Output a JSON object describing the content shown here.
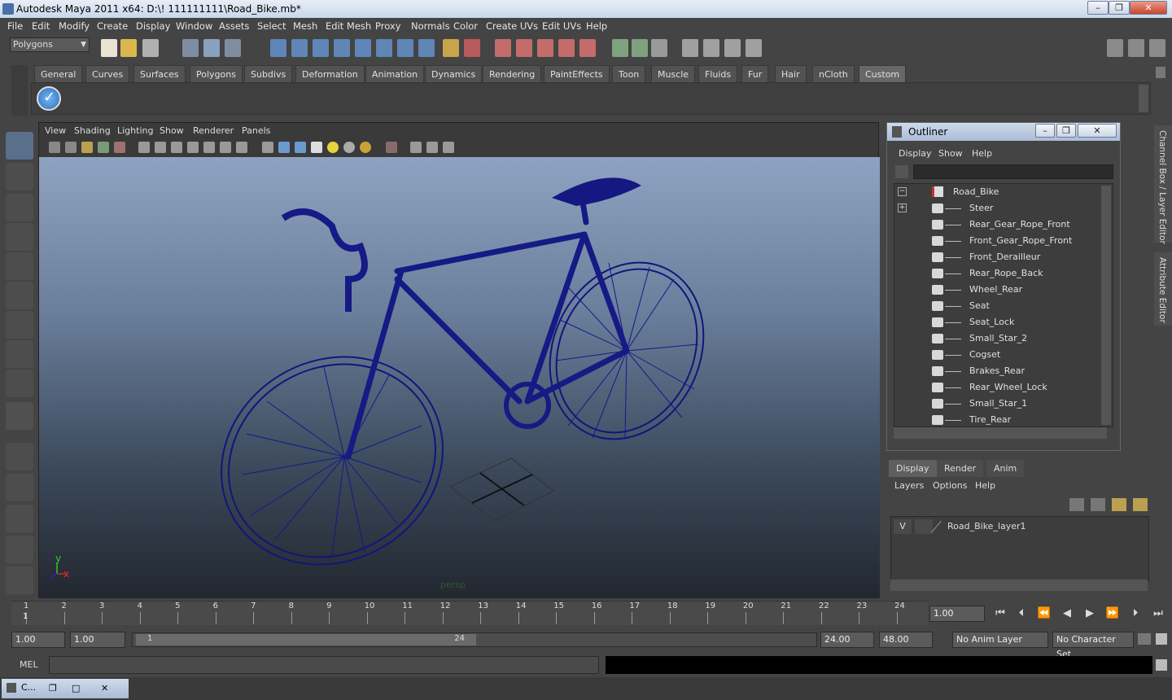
{
  "window": {
    "title": "Autodesk Maya 2011 x64: D:\\! 111111111\\Road_Bike.mb*",
    "minimize": "–",
    "maximize": "❐",
    "close": "✕"
  },
  "menubar": {
    "items": [
      "File",
      "Edit",
      "Modify",
      "Create",
      "Display",
      "Window",
      "Assets",
      "Select",
      "Mesh",
      "Edit Mesh",
      "Proxy",
      "Normals",
      "Color",
      "Create UVs",
      "Edit UVs",
      "Help"
    ]
  },
  "status": {
    "menu_set": "Polygons"
  },
  "shelf": {
    "tabs": [
      "General",
      "Curves",
      "Surfaces",
      "Polygons",
      "Subdivs",
      "Deformation",
      "Animation",
      "Dynamics",
      "Rendering",
      "PaintEffects",
      "Toon",
      "Muscle",
      "Fluids",
      "Fur",
      "Hair",
      "nCloth",
      "Custom"
    ],
    "active_tab": "Custom"
  },
  "viewport": {
    "menu": [
      "View",
      "Shading",
      "Lighting",
      "Show",
      "Renderer",
      "Panels"
    ],
    "camera_label": "persp",
    "axis_x": "x",
    "axis_y": "y"
  },
  "outliner": {
    "title": "Outliner",
    "menu": [
      "Display",
      "Show",
      "Help"
    ],
    "root": "Road_Bike",
    "items": [
      "Steer",
      "Rear_Gear_Rope_Front",
      "Front_Gear_Rope_Front",
      "Front_Derailleur",
      "Rear_Rope_Back",
      "Wheel_Rear",
      "Seat",
      "Seat_Lock",
      "Small_Star_2",
      "Cogset",
      "Brakes_Rear",
      "Rear_Wheel_Lock",
      "Small_Star_1",
      "Tire_Rear"
    ],
    "collapse_sign": "−",
    "expand_sign": "+"
  },
  "layer_editor": {
    "tabs": [
      "Display",
      "Render",
      "Anim"
    ],
    "active_tab": "Display",
    "menu": [
      "Layers",
      "Options",
      "Help"
    ],
    "layer": {
      "visible": "V",
      "name": "Road_Bike_layer1"
    }
  },
  "side_tabs": {
    "channel_box": "Channel Box / Layer Editor",
    "attribute_editor": "Attribute Editor"
  },
  "timeline": {
    "ticks": [
      "1",
      "2",
      "3",
      "4",
      "5",
      "6",
      "7",
      "8",
      "9",
      "10",
      "11",
      "12",
      "13",
      "14",
      "15",
      "16",
      "17",
      "18",
      "19",
      "20",
      "21",
      "22",
      "23",
      "24"
    ],
    "current_frame": "1",
    "current_time_field": "1.00"
  },
  "range": {
    "start": "1.00",
    "playback_start": "1.00",
    "slider_start": "1",
    "slider_end": "24",
    "playback_end": "24.00",
    "end": "48.00",
    "anim_layer": "No Anim Layer",
    "character_set": "No Character Set"
  },
  "command": {
    "label": "MEL"
  },
  "taskbar": {
    "item": "C..."
  }
}
